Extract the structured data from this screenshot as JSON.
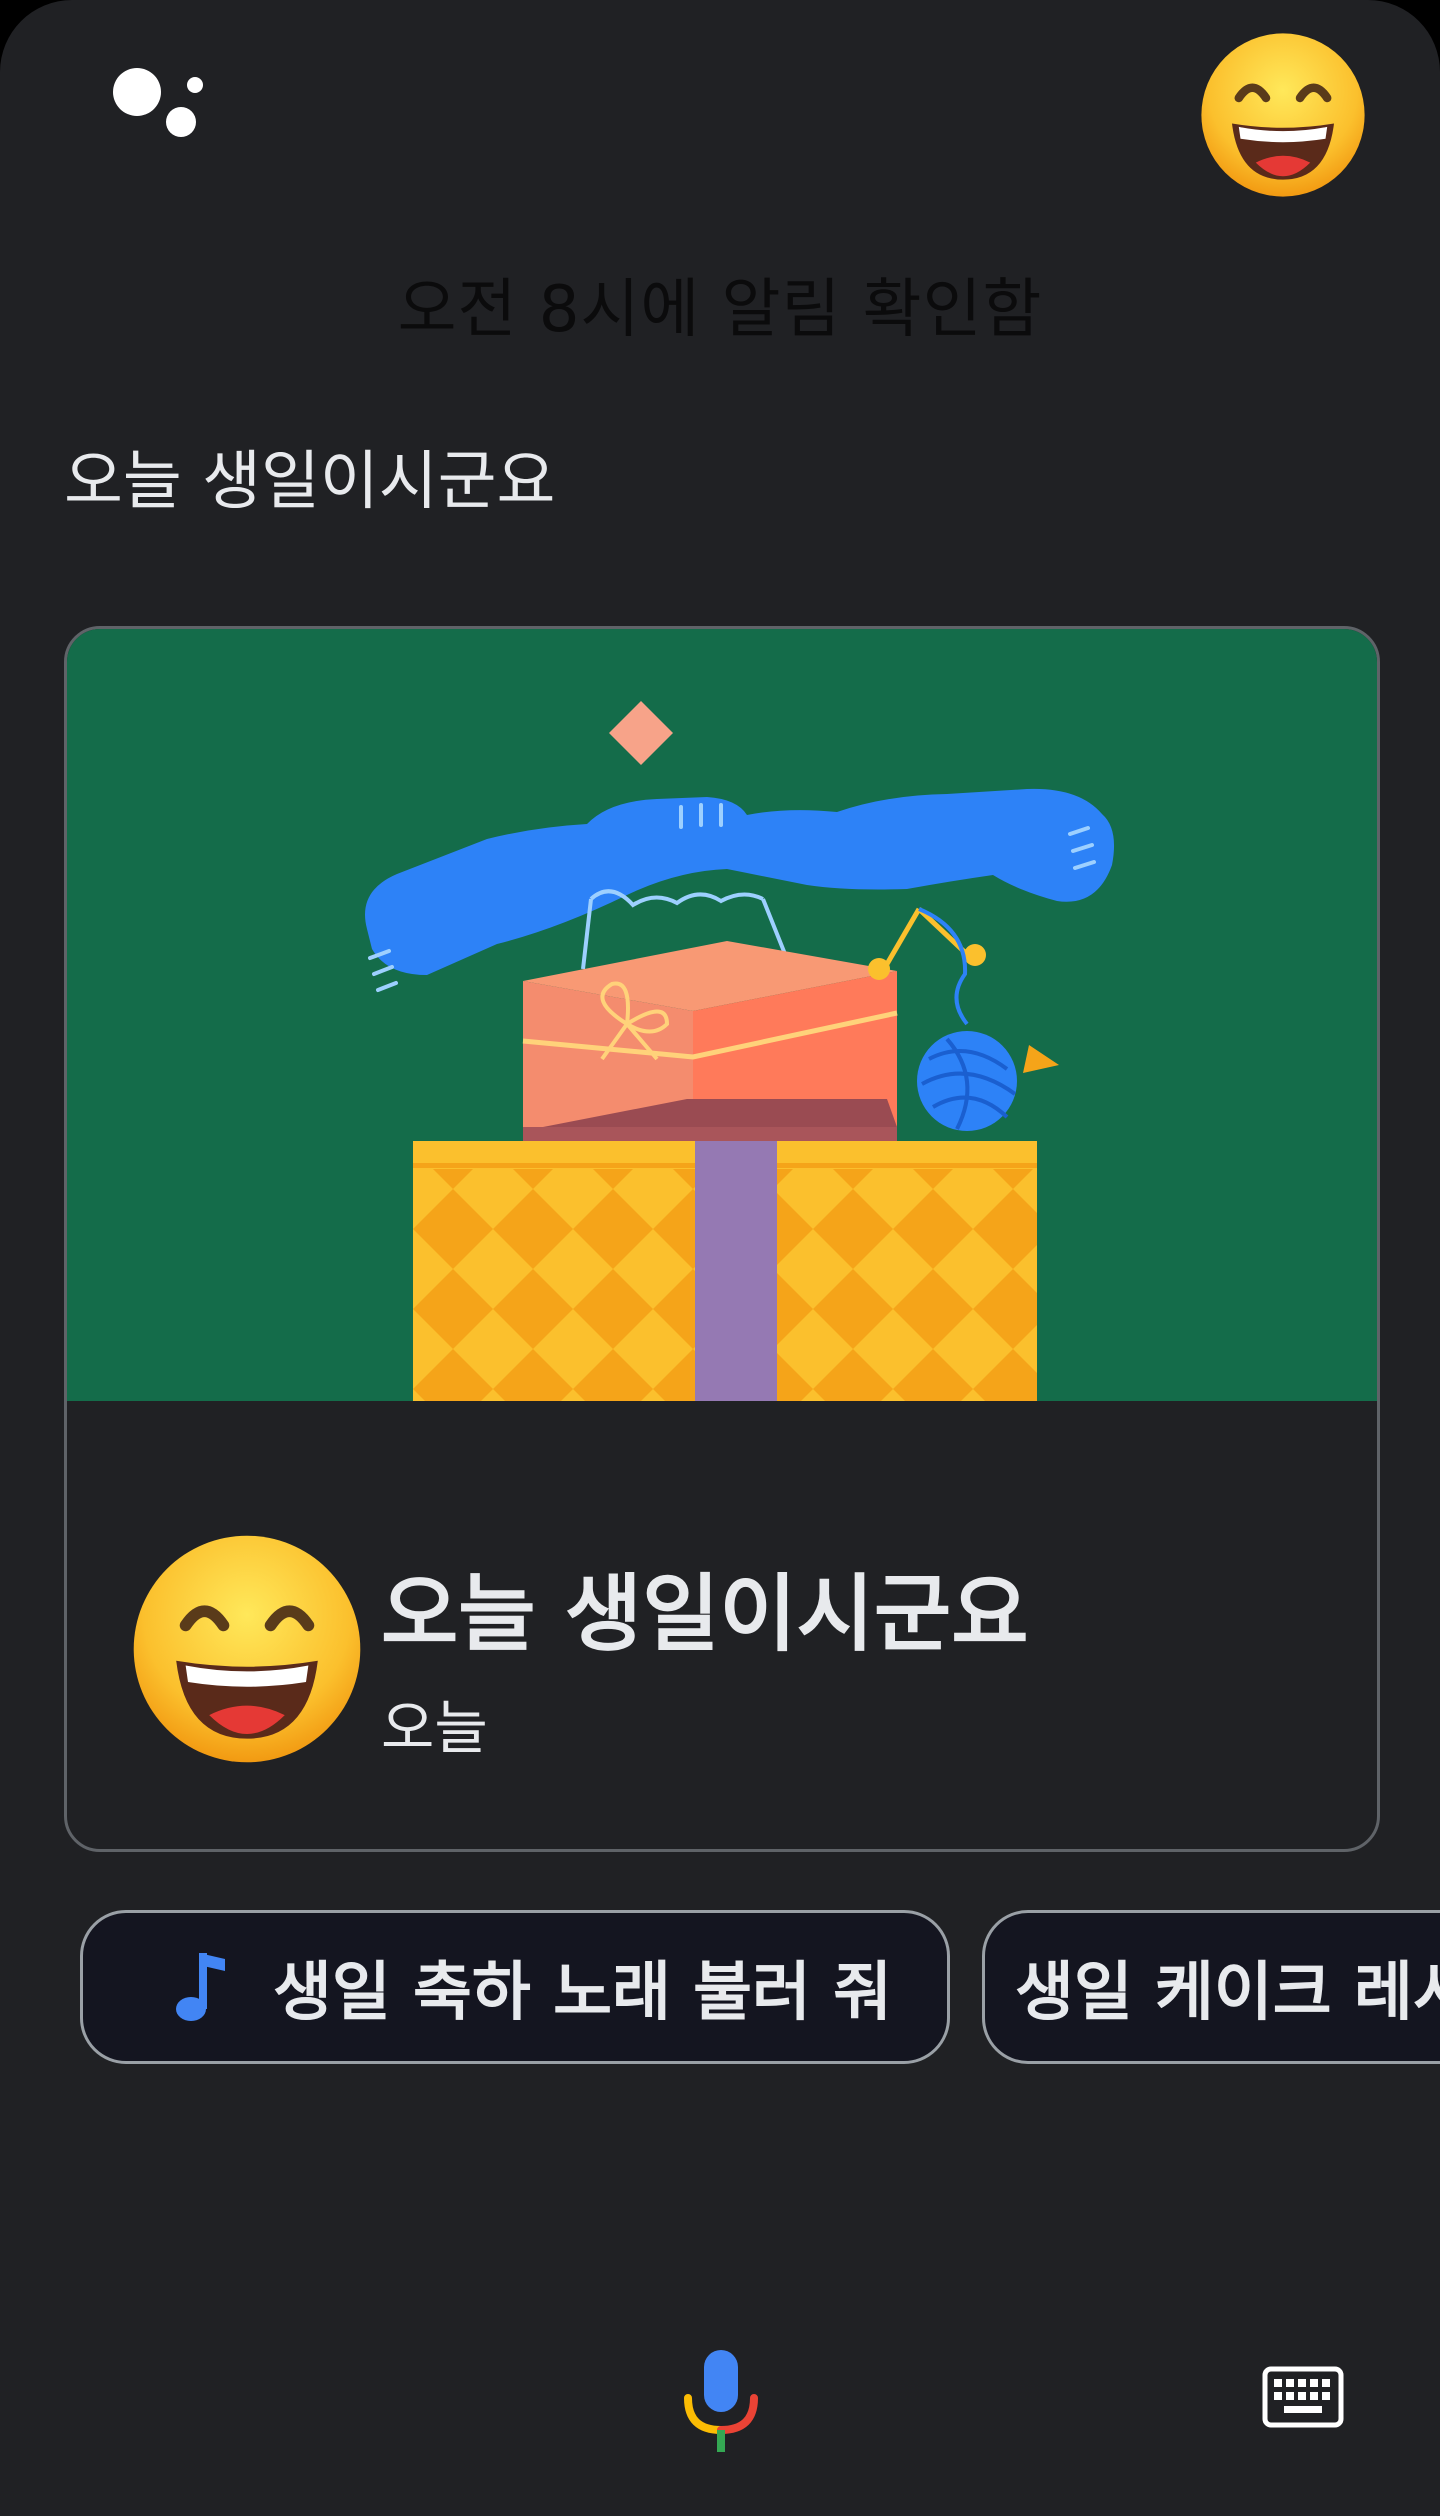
{
  "header": {
    "logo_icon": "google-assistant-dots-icon",
    "avatar_icon": "grinning-face-icon"
  },
  "transcript": {
    "text": "오전 8시에 알림 확인함"
  },
  "reply": {
    "text": "오늘 생일이시군요"
  },
  "card": {
    "illustration": "birthday-gifts-illustration",
    "emoji_icon": "grinning-face-icon",
    "title": "오늘 생일이시군요",
    "subtitle": "오늘",
    "background_color": "#146c4a"
  },
  "suggestions": [
    {
      "label": "생일 축하 노래 불러 줘",
      "icon": "music-note-icon"
    },
    {
      "label": "생일 케이크 레시피"
    }
  ],
  "bottom_bar": {
    "mic_icon": "microphone-icon",
    "keyboard_icon": "keyboard-icon"
  },
  "colors": {
    "background": "#202124",
    "text": "#e8eaed",
    "chip_border": "#9aa0a6",
    "google_blue": "#4285f4",
    "google_red": "#ea4335",
    "google_yellow": "#fbbc04",
    "google_green": "#34a853"
  }
}
